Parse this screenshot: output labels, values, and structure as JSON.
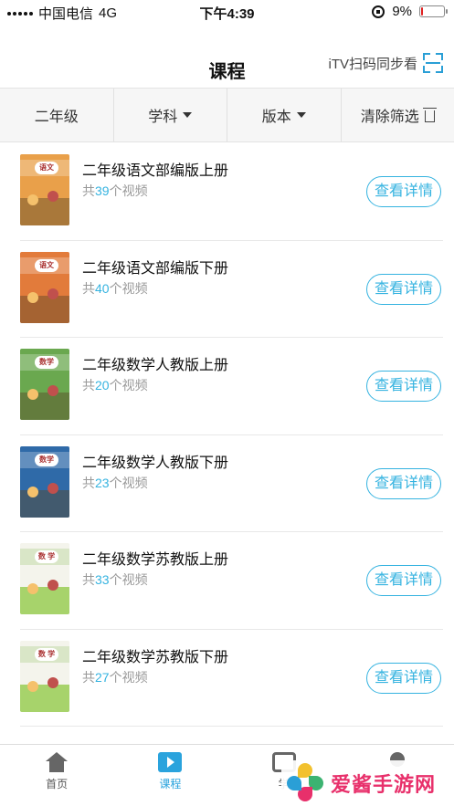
{
  "status_bar": {
    "carrier": "中国电信",
    "network": "4G",
    "time": "下午4:39",
    "battery_percent": "9%",
    "battery_level": 0.09
  },
  "header": {
    "title": "课程",
    "itv_label": "iTV扫码同步看"
  },
  "filters": {
    "grade": "二年级",
    "subject": "学科",
    "edition": "版本",
    "clear": "清除筛选"
  },
  "courses": [
    {
      "title": "二年级语文部编版上册",
      "prefix": "共",
      "count": "39",
      "suffix": "个视频",
      "button": "查看详情",
      "cover_tag": "语文",
      "cover_color": "#e9a04a"
    },
    {
      "title": "二年级语文部编版下册",
      "prefix": "共",
      "count": "40",
      "suffix": "个视频",
      "button": "查看详情",
      "cover_tag": "语文",
      "cover_color": "#e27b3b"
    },
    {
      "title": "二年级数学人教版上册",
      "prefix": "共",
      "count": "20",
      "suffix": "个视频",
      "button": "查看详情",
      "cover_tag": "数学",
      "cover_color": "#6aa84f"
    },
    {
      "title": "二年级数学人教版下册",
      "prefix": "共",
      "count": "23",
      "suffix": "个视频",
      "button": "查看详情",
      "cover_tag": "数学",
      "cover_color": "#2f6aa8"
    },
    {
      "title": "二年级数学苏教版上册",
      "prefix": "共",
      "count": "33",
      "suffix": "个视频",
      "button": "查看详情",
      "cover_tag": "数 学",
      "cover_color": "#f4f4ec"
    },
    {
      "title": "二年级数学苏教版下册",
      "prefix": "共",
      "count": "27",
      "suffix": "个视频",
      "button": "查看详情",
      "cover_tag": "数 学",
      "cover_color": "#f4f4ec"
    }
  ],
  "tabbar": {
    "home": "首页",
    "course": "课程",
    "study": "学",
    "me": ""
  },
  "watermark": {
    "text": "爱酱手游网"
  },
  "colors": {
    "accent": "#35b3e0",
    "tab_active": "#2aa3dd",
    "battery_low": "#e02020"
  }
}
